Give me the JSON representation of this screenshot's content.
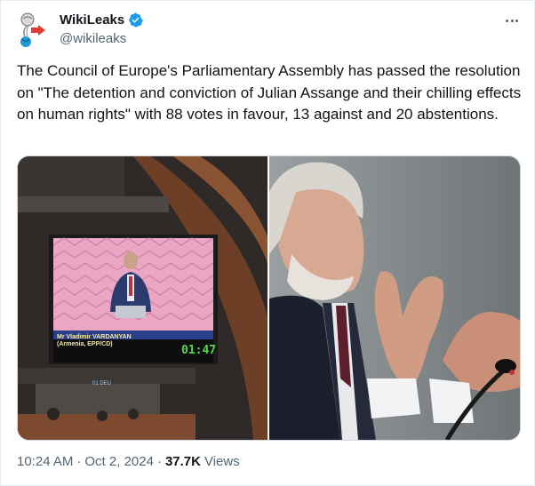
{
  "tweet": {
    "author_name": "WikiLeaks",
    "author_handle": "@wikileaks",
    "text": "The Council of Europe's Parliamentary Assembly has passed the resolution on \"The detention and conviction of Julian Assange and their chilling effects on human rights\" with 88 votes in favour, 13 against and 20 abstentions.",
    "time": "10:24 AM",
    "separator1": "·",
    "date": "Oct 2, 2024",
    "separator2": "·",
    "views_count": "37.7K",
    "views_label": "Views"
  },
  "media": {
    "left_image": {
      "speaker_name_line1": "Mr Vladimir VARDANYAN",
      "speaker_name_line2": "(Armenia, EPP/CD)",
      "timer": "01:47",
      "lower_screen_label": "01 DEU"
    }
  },
  "colors": {
    "verified_blue": "#1d9bf0",
    "text": "#0f1419",
    "muted": "#536471",
    "border": "#cfd9de"
  },
  "icons": {
    "avatar": "wikileaks-logo-icon",
    "verified": "verified-badge-icon",
    "more": "more-options-icon"
  }
}
